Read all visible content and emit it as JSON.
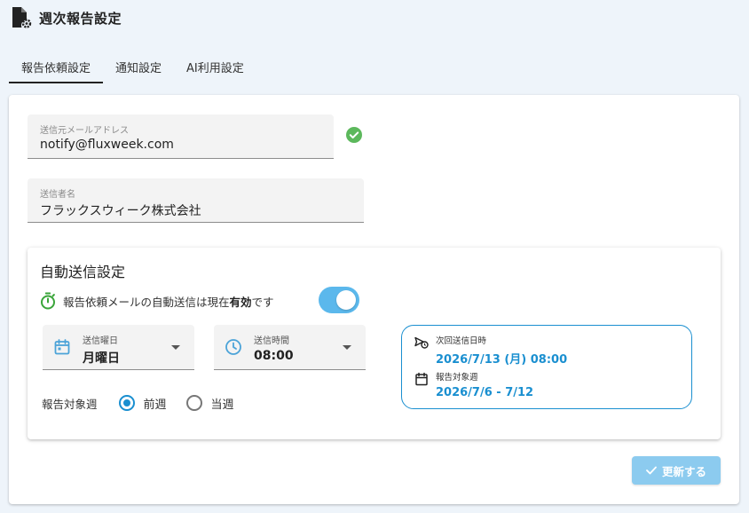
{
  "page": {
    "title": "週次報告設定",
    "icon": "settings-document-icon"
  },
  "tabs": [
    {
      "label": "報告依頼設定",
      "active": true
    },
    {
      "label": "通知設定",
      "active": false
    },
    {
      "label": "AI利用設定",
      "active": false
    }
  ],
  "sender": {
    "email_label": "送信元メールアドレス",
    "email_value": "notify@fluxweek.com",
    "email_verified_icon": "check-circle-icon",
    "name_label": "送信者名",
    "name_value": "フラックスウィーク株式会社"
  },
  "auto_send": {
    "title": "自動送信設定",
    "status_prefix": "報告依頼メールの自動送信は現在 ",
    "status_value": "有効",
    "status_suffix": " です",
    "enabled": true,
    "weekday_label": "送信曜日",
    "weekday_value": "月曜日",
    "time_label": "送信時間",
    "time_value": "08:00",
    "target_week_label": "報告対象週",
    "target_options": [
      {
        "label": "前週",
        "selected": true
      },
      {
        "label": "当週",
        "selected": false
      }
    ],
    "next_send_label": "次回送信日時",
    "next_send_value": "2026/7/13 (月) 08:00",
    "target_range_label": "報告対象週",
    "target_range_value": "2026/7/6 - 7/12"
  },
  "actions": {
    "update_label": "更新する"
  },
  "colors": {
    "accent": "#1a8fd0",
    "toggle": "#5bb8ec",
    "success": "#5cb85c",
    "disabled_button": "#8ccbef"
  }
}
